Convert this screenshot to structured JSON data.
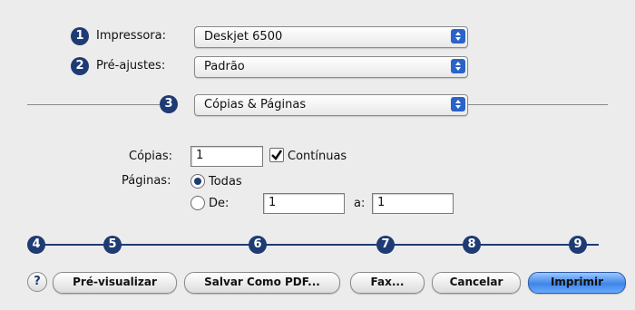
{
  "callouts": [
    "1",
    "2",
    "3",
    "4",
    "5",
    "6",
    "7",
    "8",
    "9"
  ],
  "printer": {
    "label": "Impressora:",
    "value": "Deskjet 6500"
  },
  "presets": {
    "label": "Pré-ajustes:",
    "value": "Padrão"
  },
  "panel": {
    "value": "Cópias & Páginas"
  },
  "copies": {
    "label": "Cópias:",
    "value": "1",
    "collated_label": "Contínuas",
    "collated_checked": true
  },
  "pages": {
    "label": "Páginas:",
    "all_label": "Todas",
    "all_selected": true,
    "from_label": "De:",
    "from_value": "1",
    "to_label": "a:",
    "to_value": "1"
  },
  "buttons": {
    "help_label": "?",
    "preview_label": "Pré-visualizar",
    "save_pdf_label": "Salvar Como PDF...",
    "fax_label": "Fax...",
    "cancel_label": "Cancelar",
    "print_label": "Imprimir"
  },
  "icons": {
    "popup_arrows": "up-down-arrows-icon",
    "checkbox_check": "checkmark-icon",
    "help": "help-icon"
  },
  "colors": {
    "accent": "#1f3b73",
    "popup_arrow_bg": "#2a63c9",
    "primary_button": "#3f86e8"
  }
}
